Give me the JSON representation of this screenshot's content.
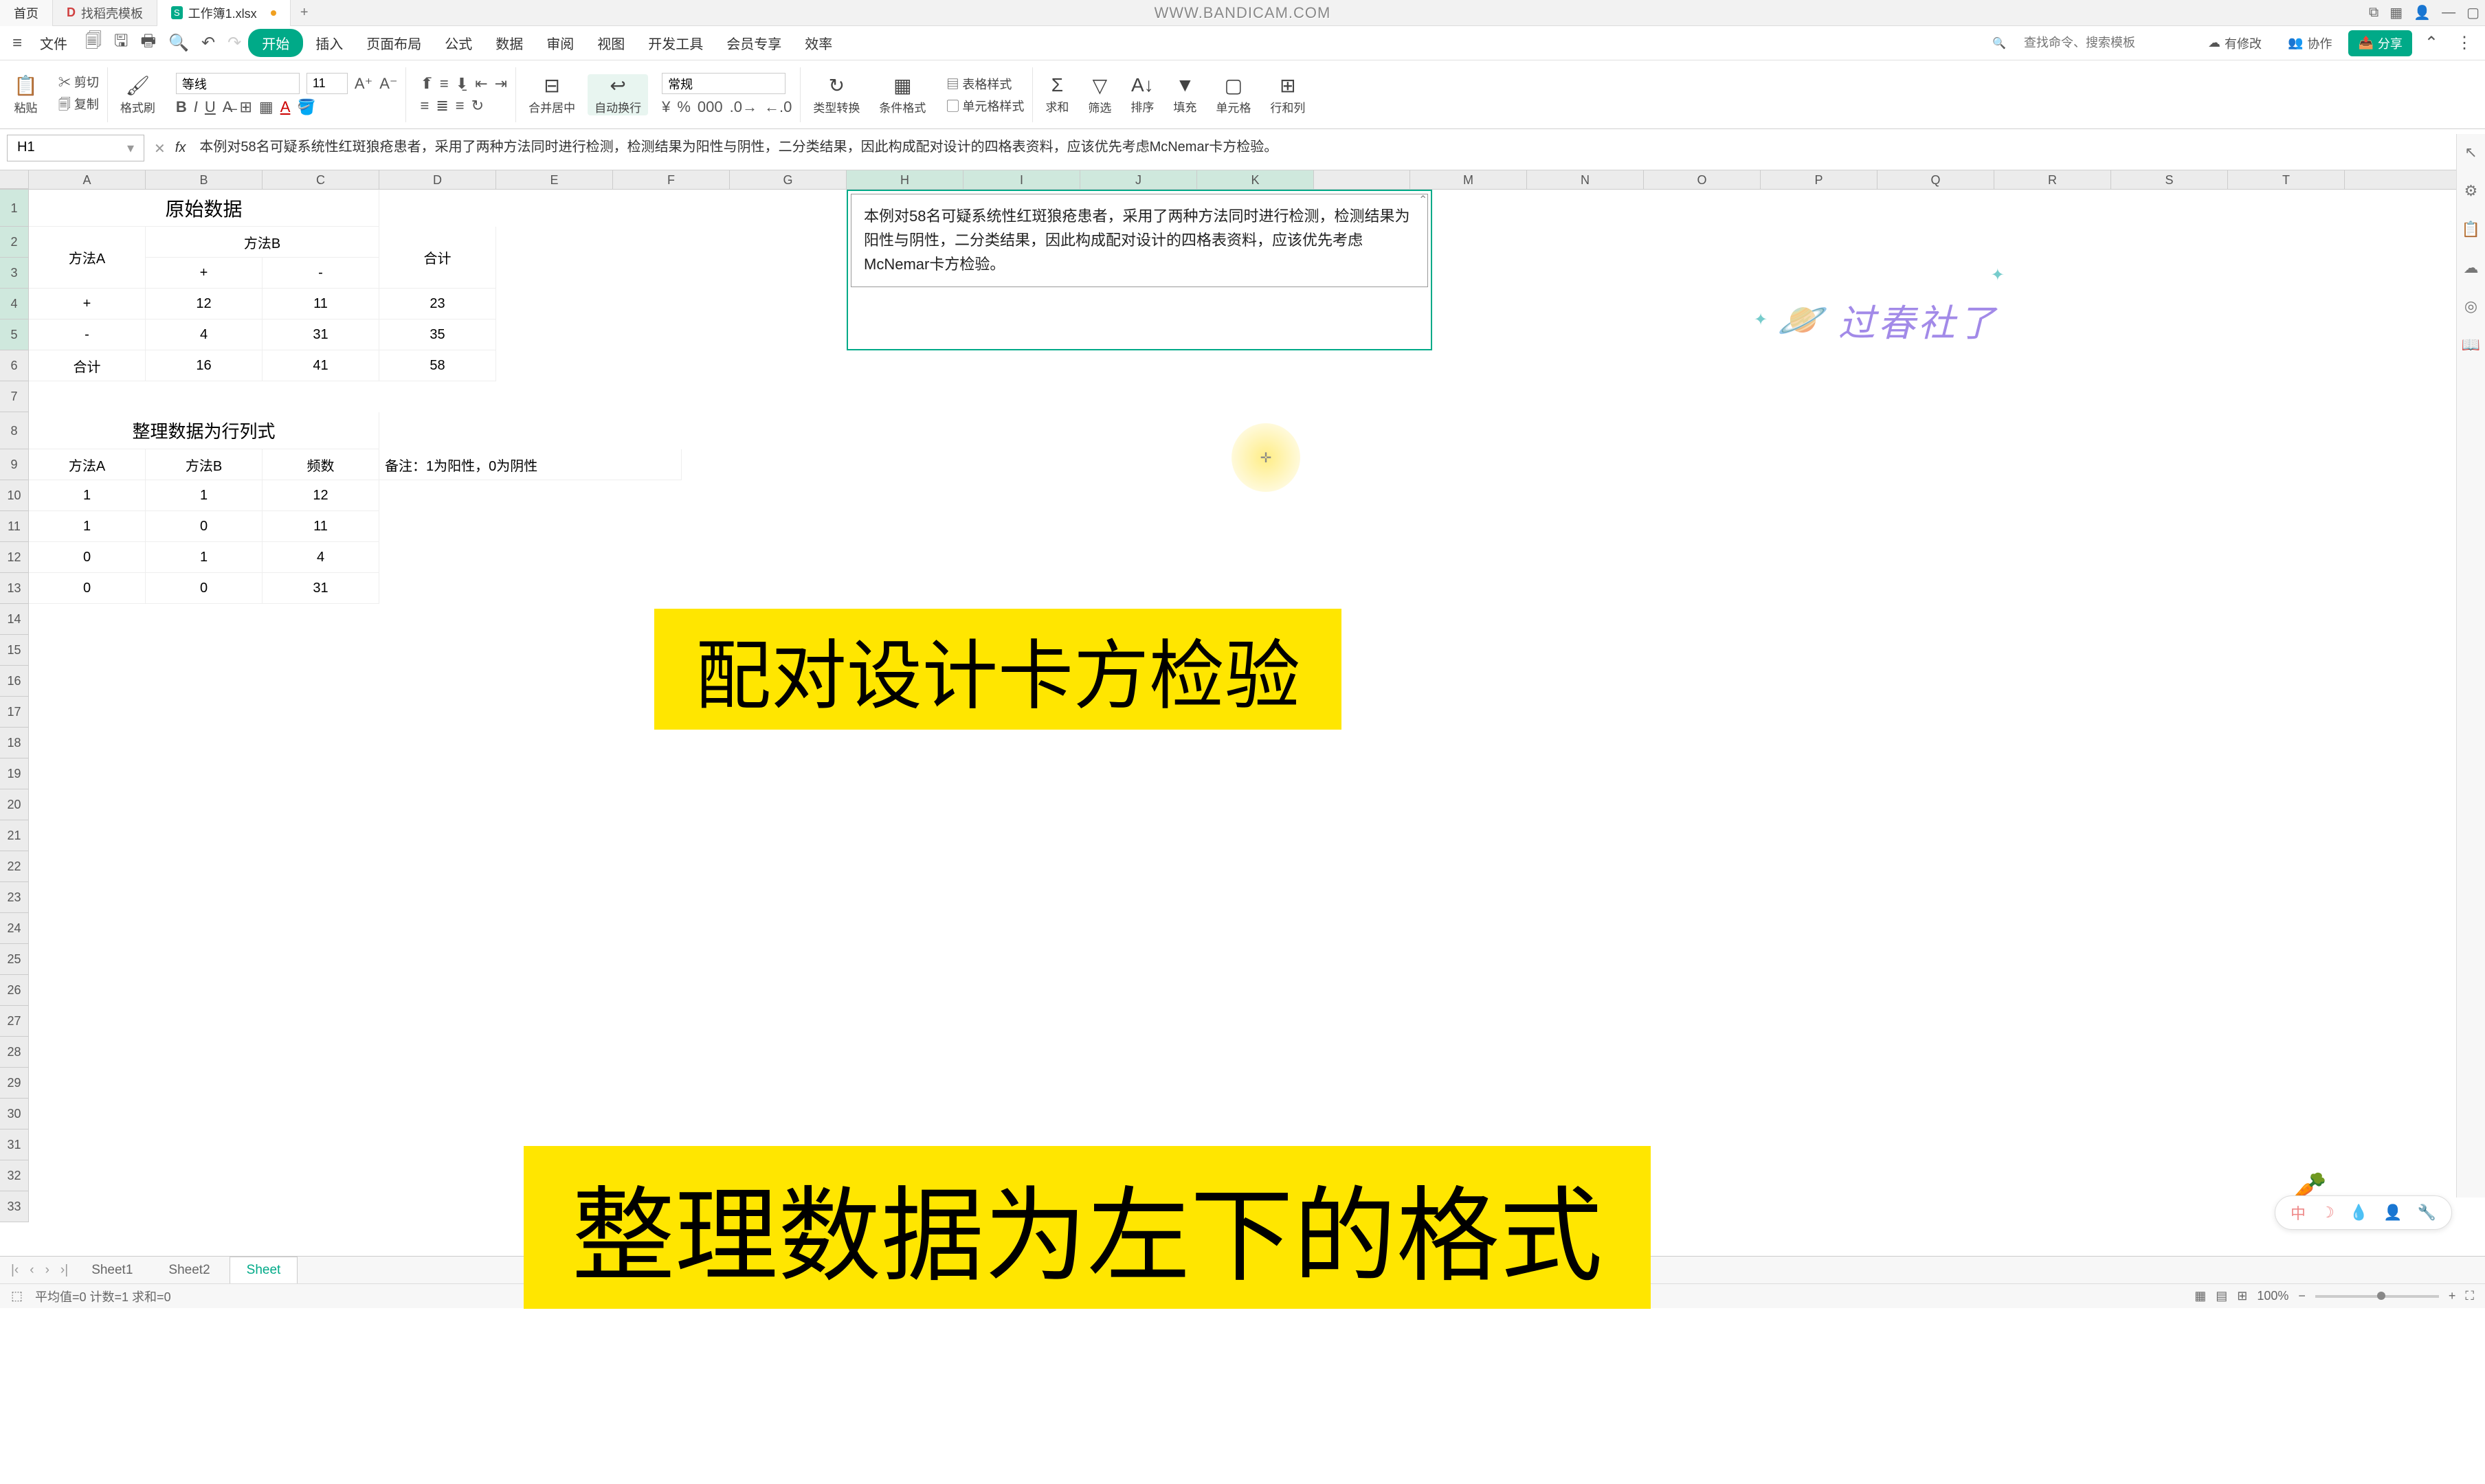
{
  "titlebar": {
    "tab_home": "首页",
    "tab_docer": "找稻壳模板",
    "tab_file": "工作簿1.xlsx",
    "bandicam": "WWW.BANDICAM.COM"
  },
  "menubar": {
    "file": "文件",
    "tabs": [
      "开始",
      "插入",
      "页面布局",
      "公式",
      "数据",
      "审阅",
      "视图",
      "开发工具",
      "会员专享",
      "效率"
    ],
    "search_placeholder": "查找命令、搜索模板",
    "pending": "有修改",
    "collab": "协作",
    "share": "分享"
  },
  "ribbon": {
    "paste": "粘贴",
    "cut": "剪切",
    "copy": "复制",
    "format_painter": "格式刷",
    "font_name": "等线",
    "font_size": "11",
    "merge": "合并居中",
    "wrap": "自动换行",
    "number_format": "常规",
    "convert": "类型转换",
    "cond_fmt": "条件格式",
    "table_style": "表格样式",
    "cell_style": "单元格样式",
    "sum": "求和",
    "filter": "筛选",
    "sort": "排序",
    "fill": "填充",
    "cell": "单元格",
    "row_col": "行和列"
  },
  "formulabar": {
    "cell_ref": "H1",
    "formula": "本例对58名可疑系统性红斑狼疮患者，采用了两种方法同时进行检测，检测结果为阳性与阴性，二分类结果，因此构成配对设计的四格表资料，应该优先考虑McNemar卡方检验。"
  },
  "columns": [
    "A",
    "B",
    "C",
    "D",
    "E",
    "F",
    "G",
    "H",
    "I",
    "J",
    "K",
    "",
    "M",
    "N",
    "O",
    "P",
    "Q",
    "R",
    "S",
    "T"
  ],
  "cells": {
    "r1_title": "原始数据",
    "r2_a": "方法A",
    "r2_b": "方法B",
    "r2_d_total": "合计",
    "r3_b": "+",
    "r3_c": "-",
    "r4_a": "+",
    "r4_b": "12",
    "r4_c": "11",
    "r4_d": "23",
    "r5_a": "-",
    "r5_b": "4",
    "r5_c": "31",
    "r5_d": "35",
    "r6_a": "合计",
    "r6_b": "16",
    "r6_c": "41",
    "r6_d": "58",
    "r8_title": "整理数据为行列式",
    "r9_a": "方法A",
    "r9_b": "方法B",
    "r9_c": "频数",
    "r9_d": "备注：1为阳性，0为阴性",
    "r10_a": "1",
    "r10_b": "1",
    "r10_c": "12",
    "r11_a": "1",
    "r11_b": "0",
    "r11_c": "11",
    "r12_a": "0",
    "r12_b": "1",
    "r12_c": "4",
    "r13_a": "0",
    "r13_b": "0",
    "r13_c": "31"
  },
  "note_text": "本例对58名可疑系统性红斑狼疮患者，采用了两种方法同时进行检测，检测结果为阳性与阴性，二分类结果，因此构成配对设计的四格表资料，应该优先考虑McNemar卡方检验。",
  "overlays": {
    "big_title": "配对设计卡方检验",
    "sub_title": "整理数据为左下的格式",
    "saturn": "过春社了"
  },
  "sheet_tabs": {
    "s1": "Sheet1",
    "s2": "Sheet2",
    "s3": "Sheet"
  },
  "statusbar": {
    "avg": "平均值=0  计数=1  求和=0",
    "zoom": "100%"
  }
}
